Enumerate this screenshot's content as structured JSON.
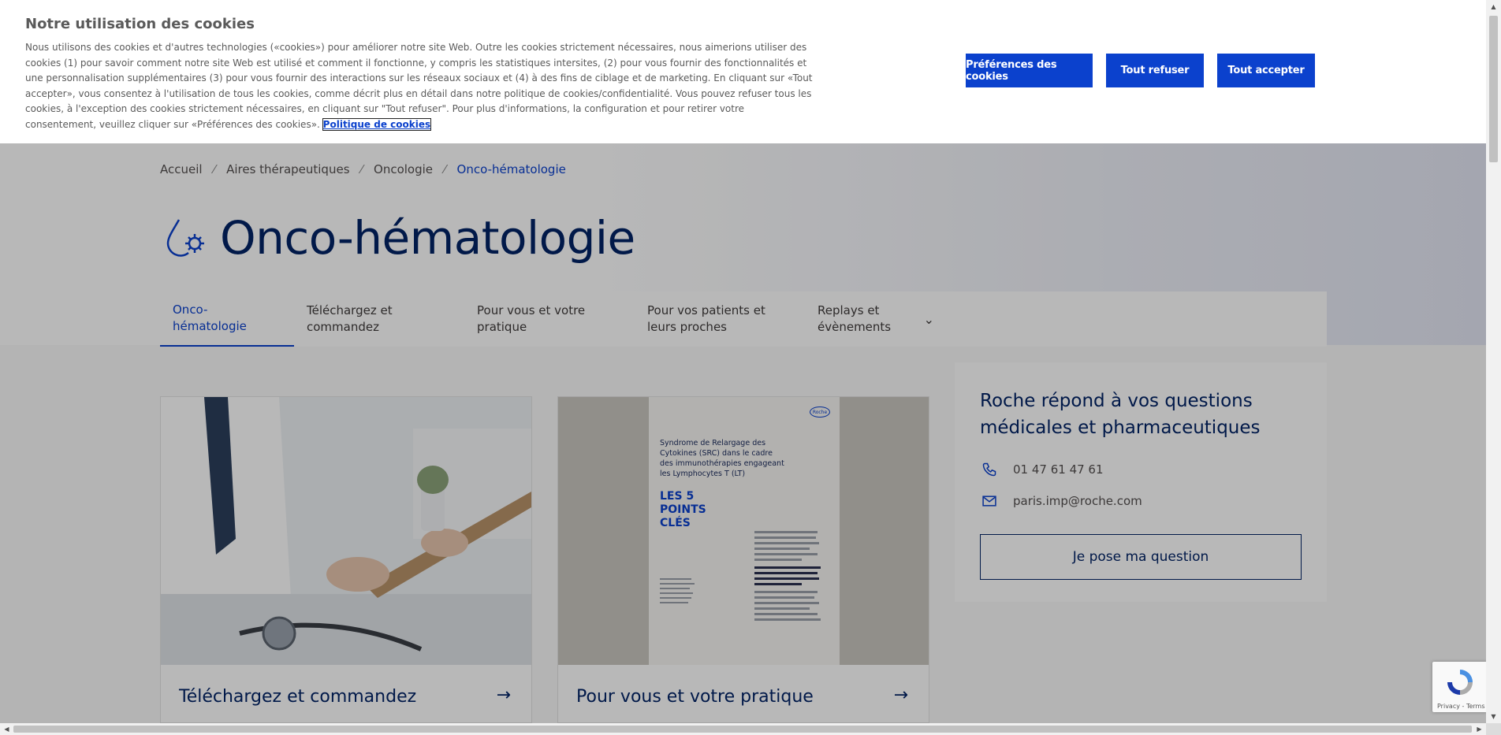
{
  "cookie_banner": {
    "title": "Notre utilisation des cookies",
    "text": "Nous utilisons des cookies et d'autres technologies («cookies») pour améliorer notre site Web. Outre les cookies strictement nécessaires, nous aimerions utiliser des cookies (1) pour savoir comment notre site Web est utilisé et comment il fonctionne, y compris les statistiques intersites, (2) pour vous fournir des fonctionnalités et une personnalisation supplémentaires (3) pour vous fournir des interactions sur les réseaux sociaux et (4) à des fins de ciblage et de marketing. En cliquant sur «Tout accepter», vous consentez à l'utilisation de tous les cookies, comme décrit plus en détail dans notre politique de cookies/confidentialité. Vous pouvez refuser tous les cookies, à l'exception des cookies strictement nécessaires, en cliquant sur \"Tout refuser\". Pour plus d'informations, la configuration et pour retirer votre consentement, veuillez cliquer sur «Préférences des cookies». ",
    "policy_link": "Politique de cookies",
    "btn_preferences": "Préférences des cookies",
    "btn_refuse": "Tout refuser",
    "btn_accept": "Tout accepter"
  },
  "breadcrumb": {
    "items": [
      "Accueil",
      "Aires thérapeutiques",
      "Oncologie"
    ],
    "current": "Onco-hématologie",
    "separator": "⁄"
  },
  "page_title": "Onco-hématologie",
  "tabs": [
    {
      "label": "Onco-hématologie"
    },
    {
      "label": "Téléchargez et commandez"
    },
    {
      "label": "Pour vous et votre pratique"
    },
    {
      "label": "Pour vos patients et leurs proches"
    },
    {
      "label": "Replays et évènements"
    }
  ],
  "cards": [
    {
      "label": "Téléchargez et commandez"
    },
    {
      "label": "Pour vous et votre pratique"
    }
  ],
  "brochure": {
    "logo": "Roche",
    "heading": "Syndrome de Relargage des Cytokines (SRC) dans le cadre des immunothérapies engageant les Lymphocytes T (LT)",
    "subheading": "LES 5 POINTS CLÉS"
  },
  "contact": {
    "title": "Roche répond à vos questions médicales et pharmaceutiques",
    "phone": "01 47 61 47 61",
    "email": "paris.imp@roche.com",
    "button": "Je pose ma question"
  },
  "recaptcha": {
    "links": "Privacy - Terms"
  },
  "colors": {
    "accent": "#0b41cd",
    "heading": "#022366",
    "text": "#544f4f"
  }
}
